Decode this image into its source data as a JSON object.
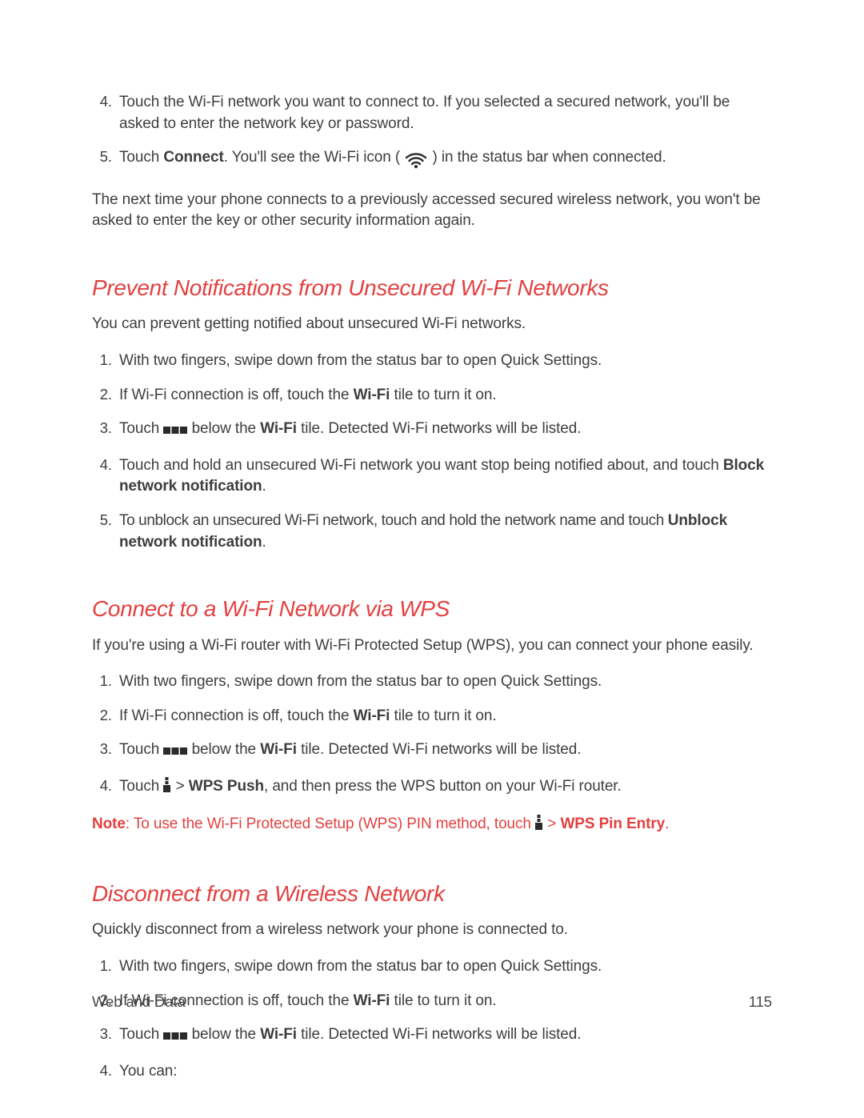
{
  "intro_list": {
    "start": 4,
    "items": [
      {
        "text": "Touch the Wi-Fi network you want to connect to. If you selected a secured network, you'll be asked to enter the network key or password."
      },
      {
        "pre": "Touch ",
        "bold1": "Connect",
        "mid": ". You'll see the Wi-Fi icon (",
        "post": ") in the status bar when connected."
      }
    ]
  },
  "intro_followup": "The next time your phone connects to a previously accessed secured wireless network, you won't be asked to enter the key or other security information again.",
  "section1": {
    "heading": "Prevent Notifications from Unsecured Wi-Fi Networks",
    "intro": "You can prevent getting notified about unsecured Wi-Fi networks.",
    "items": [
      {
        "text": "With two fingers, swipe down from the status bar to open Quick Settings."
      },
      {
        "pre": "If Wi-Fi connection is off, touch the ",
        "bold1": "Wi-Fi",
        "post": " tile to turn it on."
      },
      {
        "pre": "Touch ",
        "icon": "three-squares",
        "mid": " below the ",
        "bold1": "Wi-Fi",
        "post": " tile. Detected Wi-Fi networks will be listed."
      },
      {
        "pre": "Touch and hold an unsecured Wi-Fi network you want stop being notified about, and touch ",
        "bold1": "Block network notification",
        "post": "."
      },
      {
        "pre": "To unblock an unsecured Wi-Fi network, touch and hold the network name and touch ",
        "bold1": "Unblock network notification",
        "post": ".",
        "tight": true
      }
    ]
  },
  "section2": {
    "heading": "Connect to a Wi-Fi Network via WPS",
    "intro": "If you're using a Wi-Fi router with Wi-Fi Protected Setup (WPS), you can connect your phone easily.",
    "items": [
      {
        "text": "With two fingers, swipe down from the status bar to open Quick Settings."
      },
      {
        "pre": "If Wi-Fi connection is off, touch the ",
        "bold1": "Wi-Fi",
        "post": " tile to turn it on."
      },
      {
        "pre": "Touch ",
        "icon": "three-squares",
        "mid": " below the ",
        "bold1": "Wi-Fi",
        "post": " tile. Detected Wi-Fi networks will be listed."
      },
      {
        "pre": "Touch ",
        "icon": "menu-dots",
        "mid": " > ",
        "bold1": "WPS Push",
        "post": ", and then press the WPS button on your Wi-Fi router."
      }
    ],
    "note": {
      "label": "Note",
      "pre": ":  To use the Wi-Fi Protected Setup (WPS) PIN method, touch ",
      "mid": " > ",
      "bold": "WPS Pin Entry",
      "post": "."
    }
  },
  "section3": {
    "heading": "Disconnect from a Wireless Network",
    "intro": "Quickly disconnect from a wireless network your phone is connected to.",
    "items": [
      {
        "text": "With two fingers, swipe down from the status bar to open Quick Settings."
      },
      {
        "pre": "If Wi-Fi connection is off, touch the ",
        "bold1": "Wi-Fi",
        "post": " tile to turn it on."
      },
      {
        "pre": "Touch ",
        "icon": "three-squares",
        "mid": " below the ",
        "bold1": "Wi-Fi",
        "post": " tile. Detected Wi-Fi networks will be listed."
      },
      {
        "text": "You can:"
      }
    ]
  },
  "footer": {
    "left": "Web and Data",
    "right": "115"
  }
}
